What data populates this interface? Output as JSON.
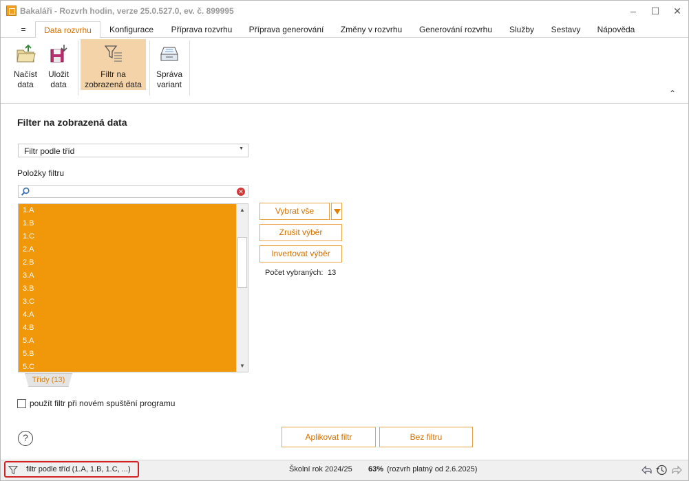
{
  "window": {
    "title": "Bakaláři - Rozvrh hodin, verze 25.0.527.0, ev. č. 899995",
    "controls": [
      "–",
      "☐",
      "✕"
    ]
  },
  "menu": {
    "hamburger": "=",
    "tabs": [
      "Data rozvrhu",
      "Konfigurace",
      "Příprava rozvrhu",
      "Příprava generování",
      "Změny v rozvrhu",
      "Generování rozvrhu",
      "Služby",
      "Sestavy",
      "Nápověda"
    ],
    "active": "Data rozvrhu"
  },
  "ribbon": {
    "load": {
      "line1": "Načíst",
      "line2": "data"
    },
    "save": {
      "line1": "Uložit",
      "line2": "data"
    },
    "filter": {
      "line1": "Filtr na",
      "line2": "zobrazená data"
    },
    "variants": {
      "line1": "Správa",
      "line2": "variant"
    },
    "collapse": "⌃"
  },
  "panel": {
    "title": "Filter na zobrazená data",
    "filter_type": "Filtr podle tříd",
    "items_label": "Položky filtru",
    "search_value": "",
    "items": [
      "1.A",
      "1.B",
      "1.C",
      "2.A",
      "2.B",
      "3.A",
      "3.B",
      "3.C",
      "4.A",
      "4.B",
      "5.A",
      "5.B",
      "5.C"
    ],
    "list_tab": "Třídy (13)",
    "select_all": "Vybrat vše",
    "clear_selection": "Zrušit výběr",
    "invert_selection": "Invertovat výběr",
    "selected_count_label": "Počet vybraných:",
    "selected_count": "13",
    "use_on_start_label": "použít filtr při novém spuštění programu",
    "use_on_start_checked": false,
    "help": "?",
    "apply_button": "Aplikovat filtr",
    "no_filter_button": "Bez filtru"
  },
  "status": {
    "filter_text": "filtr podle tříd (1.A, 1.B, 1.C, ...)",
    "school_year": "Školní rok 2024/25",
    "percent": "63%",
    "valid_from": "(rozvrh platný od 2.6.2025)"
  },
  "colors": {
    "accent": "#f0970a",
    "accent_text": "#d07000",
    "active_ribbon": "#f5d3a8",
    "status_highlight": "#d32020"
  }
}
